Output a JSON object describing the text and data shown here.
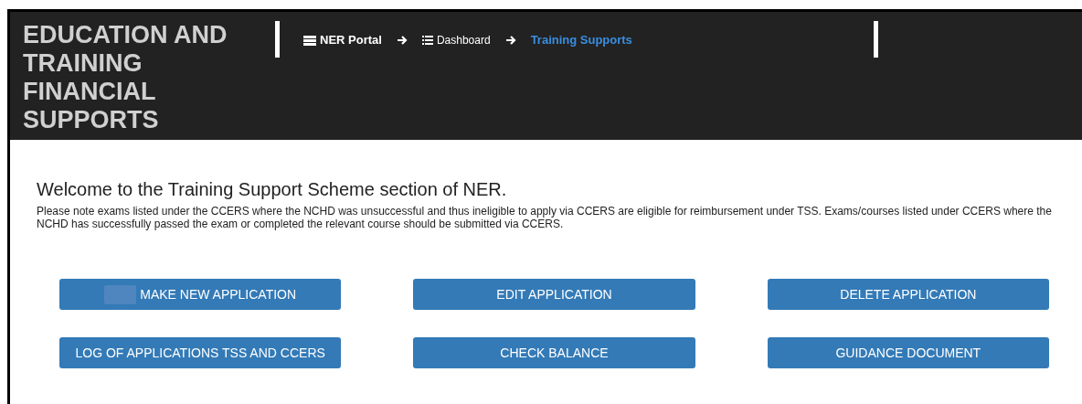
{
  "header": {
    "title": "EDUCATION AND TRAINING FINANCIAL SUPPORTS",
    "breadcrumbs": [
      {
        "label": "NER Portal",
        "kind": "portal",
        "selected": false
      },
      {
        "label": "Dashboard",
        "kind": "list",
        "selected": false
      },
      {
        "label": "Training Supports",
        "kind": "current",
        "selected": true
      }
    ]
  },
  "welcome": {
    "heading": "Welcome to the Training Support Scheme section of NER.",
    "note": "Please note exams listed under the CCERS where the NCHD was unsuccessful and thus ineligible to apply via CCERS are eligible for reimbursement under TSS. Exams/courses listed under CCERS where the NCHD has successfully passed the exam or completed the relevant course should be submitted via CCERS."
  },
  "buttons": [
    {
      "label": "MAKE NEW APPLICATION",
      "icon": true
    },
    {
      "label": "EDIT APPLICATION",
      "icon": false
    },
    {
      "label": "DELETE APPLICATION",
      "icon": false
    },
    {
      "label": "LOG OF APPLICATIONS TSS AND CCERS",
      "icon": false
    },
    {
      "label": "CHECK BALANCE",
      "icon": false
    },
    {
      "label": "GUIDANCE DOCUMENT",
      "icon": false
    }
  ]
}
